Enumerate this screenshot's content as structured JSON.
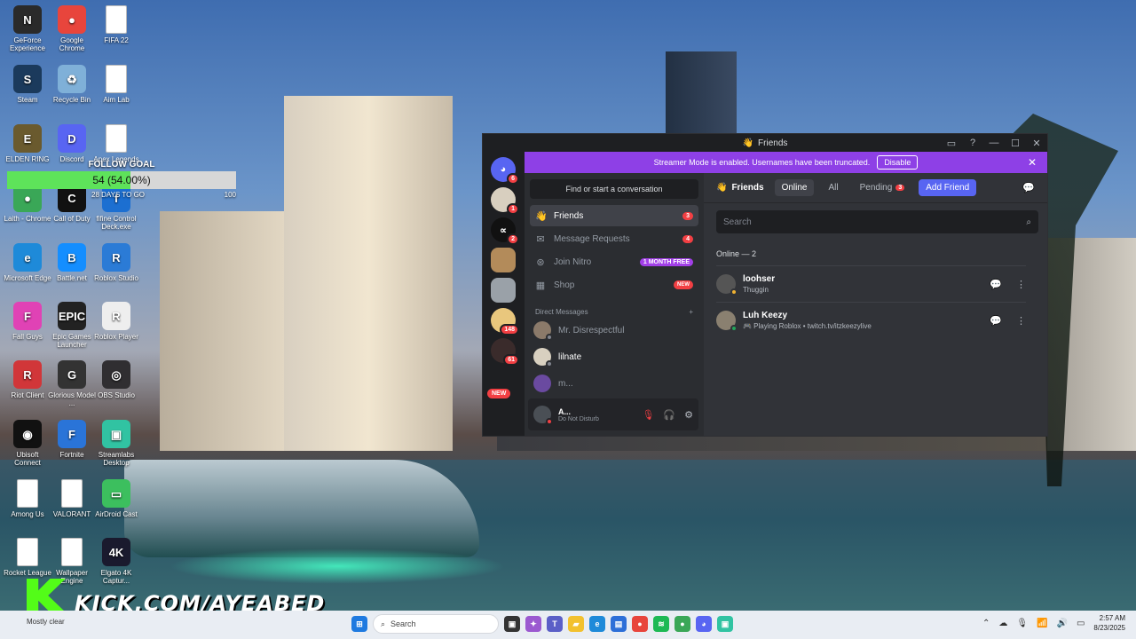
{
  "desktop": {
    "icons": [
      {
        "label": "GeForce Experience",
        "color": "#2a2a2a",
        "glyph": "N"
      },
      {
        "label": "Google Chrome",
        "color": "#e8453c",
        "glyph": "●"
      },
      {
        "label": "FIFA 22",
        "color": "#ffffff",
        "glyph": ""
      },
      {
        "label": "Steam",
        "color": "#1b3a5c",
        "glyph": "S"
      },
      {
        "label": "Recycle Bin",
        "color": "#7fb0d8",
        "glyph": "♻"
      },
      {
        "label": "Aim Lab",
        "color": "#ffffff",
        "glyph": ""
      },
      {
        "label": "ELDEN RING",
        "color": "#6a5a2e",
        "glyph": "E"
      },
      {
        "label": "Discord",
        "color": "#5865f2",
        "glyph": "D"
      },
      {
        "label": "Apex Legends",
        "color": "#ffffff",
        "glyph": ""
      },
      {
        "label": "Laith - Chrome",
        "color": "#3aa757",
        "glyph": "●"
      },
      {
        "label": "Call of Duty",
        "color": "#111111",
        "glyph": "C"
      },
      {
        "label": "fifine Control Deck.exe",
        "color": "#1c6fd1",
        "glyph": "f"
      },
      {
        "label": "Microsoft Edge",
        "color": "#1e8ad9",
        "glyph": "e"
      },
      {
        "label": "Battle.net",
        "color": "#148eff",
        "glyph": "B"
      },
      {
        "label": "Roblox Studio",
        "color": "#2b7bd6",
        "glyph": "R"
      },
      {
        "label": "Fall Guys",
        "color": "#e042b5",
        "glyph": "F"
      },
      {
        "label": "Epic Games Launcher",
        "color": "#222222",
        "glyph": "EPIC"
      },
      {
        "label": "Roblox Player",
        "color": "#eeeeee",
        "glyph": "R"
      },
      {
        "label": "Riot Client",
        "color": "#d13639",
        "glyph": "R"
      },
      {
        "label": "Glorious Model ...",
        "color": "#333333",
        "glyph": "G"
      },
      {
        "label": "OBS Studio",
        "color": "#302e31",
        "glyph": "◎"
      },
      {
        "label": "Ubisoft Connect",
        "color": "#111111",
        "glyph": "◉"
      },
      {
        "label": "Fortnite",
        "color": "#2a74d8",
        "glyph": "F"
      },
      {
        "label": "Streamlabs Desktop",
        "color": "#31c3a2",
        "glyph": "▣"
      },
      {
        "label": "Among Us",
        "color": "#ffffff",
        "glyph": ""
      },
      {
        "label": "VALORANT",
        "color": "#ffffff",
        "glyph": ""
      },
      {
        "label": "AirDroid Cast",
        "color": "#3cbf5e",
        "glyph": "▭"
      },
      {
        "label": "Rocket League",
        "color": "#ffffff",
        "glyph": ""
      },
      {
        "label": "Wallpaper Engine",
        "color": "#ffffff",
        "glyph": ""
      },
      {
        "label": "Elgato 4K Captur...",
        "color": "#1a1a2e",
        "glyph": "4K"
      }
    ]
  },
  "goal": {
    "title": "FOLLOW GOAL",
    "progress_text": "54 (54.00%)",
    "progress": 0.54,
    "days_left": "28 DAYS TO GO",
    "target": "100"
  },
  "kick": {
    "url": "KICK.COM/AYEABED"
  },
  "discord": {
    "window_title": "Friends",
    "banner_text": "Streamer Mode is enabled. Usernames have been truncated.",
    "banner_button": "Disable",
    "guild_badges": [
      "6",
      "1",
      "2",
      "",
      "",
      "148",
      "61"
    ],
    "new_label": "NEW",
    "find_placeholder": "Find or start a conversation",
    "nav": [
      {
        "label": "Friends",
        "icon": "person-wave-icon",
        "badge": "3"
      },
      {
        "label": "Message Requests",
        "icon": "envelope-icon",
        "badge": "4"
      },
      {
        "label": "Join Nitro",
        "icon": "nitro-icon",
        "badge": "1 MONTH FREE"
      },
      {
        "label": "Shop",
        "icon": "shop-icon",
        "badge": "NEW"
      }
    ],
    "dm_header": "Direct Messages",
    "dms": [
      {
        "name": "Mr. Disrespectful",
        "color": "#8b7a6a"
      },
      {
        "name": "lilnate",
        "color": "#d8d0c0"
      },
      {
        "name": "m...",
        "color": "#6a4aa0"
      }
    ],
    "user": {
      "name": "A...",
      "status": "Do Not Disturb"
    },
    "toolbar": {
      "friends_label": "Friends",
      "tab_online": "Online",
      "tab_all": "All",
      "tab_pending": "Pending",
      "pending_badge": "3",
      "add_friend": "Add Friend"
    },
    "search_placeholder": "Search",
    "online_header": "Online — 2",
    "friends": [
      {
        "name": "loohser",
        "sub": "Thuggin",
        "color": "#555555"
      },
      {
        "name": "Luh Keezy",
        "sub": "🎮 Playing Roblox • twitch.tv/itzkeezylive",
        "color": "#8a8070"
      }
    ]
  },
  "taskbar": {
    "weather": "Mostly clear",
    "search_label": "Search",
    "time": "2:57 AM",
    "date": "8/23/2025"
  }
}
